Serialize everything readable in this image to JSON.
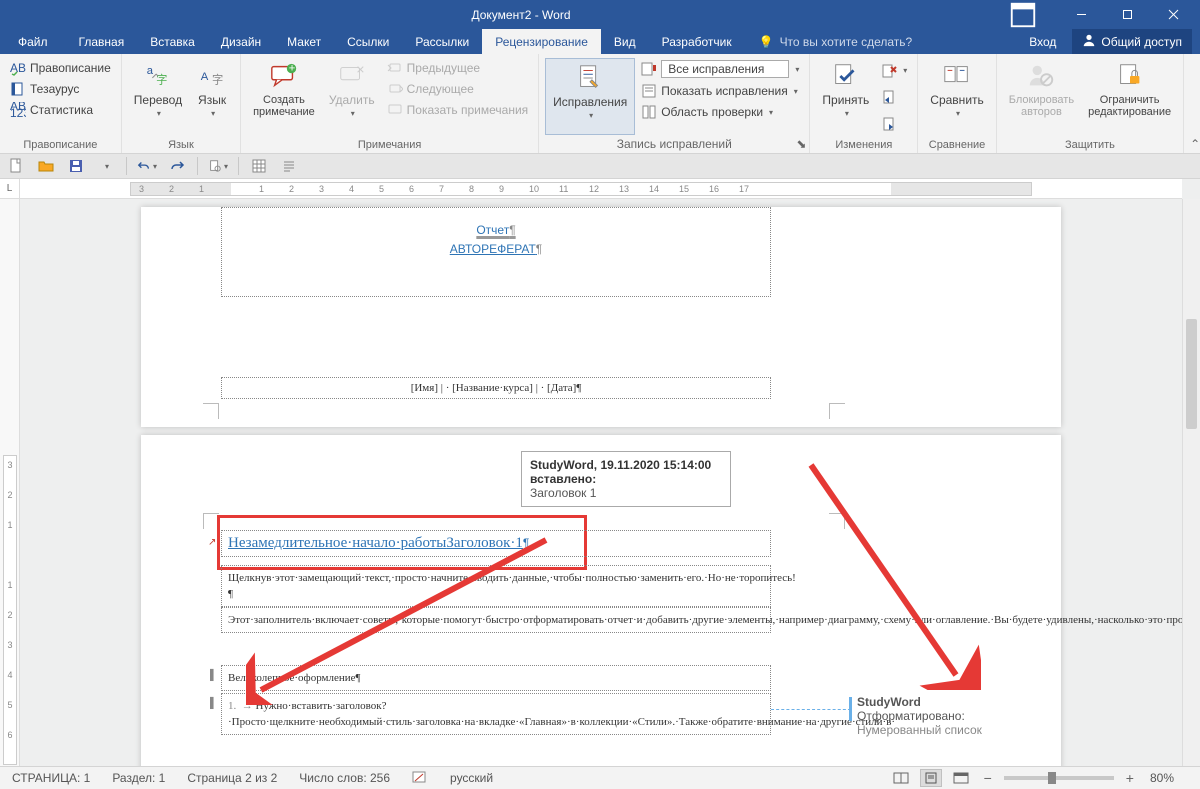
{
  "window": {
    "title": "Документ2 - Word"
  },
  "tabs": {
    "file": "Файл",
    "home": "Главная",
    "insert": "Вставка",
    "design": "Дизайн",
    "layout": "Макет",
    "references": "Ссылки",
    "mailings": "Рассылки",
    "review": "Рецензирование",
    "view": "Вид",
    "developer": "Разработчик",
    "tell_me": "Что вы хотите сделать?",
    "signin": "Вход",
    "share": "Общий доступ"
  },
  "ribbon": {
    "proofing": {
      "label": "Правописание",
      "spelling": "Правописание",
      "thesaurus": "Тезаурус",
      "stats": "Статистика"
    },
    "language": {
      "label": "Язык",
      "translate": "Перевод",
      "language": "Язык"
    },
    "comments": {
      "label": "Примечания",
      "new": "Создать\nпримечание",
      "delete": "Удалить",
      "previous": "Предыдущее",
      "next": "Следующее",
      "show": "Показать примечания"
    },
    "tracking": {
      "label": "Запись исправлений",
      "track": "Исправления",
      "display": "Все исправления",
      "show_markup": "Показать исправления",
      "reviewing_pane": "Область проверки"
    },
    "changes": {
      "label": "Изменения",
      "accept": "Принять"
    },
    "compare": {
      "label": "Сравнение",
      "compare": "Сравнить"
    },
    "protect": {
      "label": "Защитить",
      "block": "Блокировать\nавторов",
      "restrict": "Ограничить\nредактирование"
    }
  },
  "document": {
    "title": "Отчет",
    "subtitle": "АВТОРЕФЕРАТ",
    "meta_line": "[Имя] | · [Название·курса] | · [Дата]",
    "heading1_a": "Незамедлительное·начало·работы",
    "heading1_b": "Заголовок·1",
    "p1": "Щелкнув·этот·замещающий·текст,·просто·начните·вводить·данные,·чтобы·полностью·заменить·его.·Но·не·торопитесь!",
    "p2": "Этот·заполнитель·включает·советы,·которые·помогут·быстро·отформатировать·отчет·и·добавить·другие·элементы,·например·диаграмму,·схему·или·оглавление.·Вы·будете·удивлены,·насколько·это·просто.",
    "p3": "Великолепное·оформление",
    "p4": "Нужно·вставить·заголовок?·Просто·щелкните·необходимый·стиль·заголовка·на·вкладке·«Главная»·в·коллекции·«Стили».·Также·обратите·внимание·на·другие·стили·в·"
  },
  "tooltip": {
    "author_time": "StudyWord, 19.11.2020 15:14:00",
    "action": "вставлено:",
    "content": "Заголовок 1"
  },
  "comment": {
    "author": "StudyWord",
    "label": "Отформатировано:",
    "value": "Нумерованный список"
  },
  "status": {
    "page": "СТРАНИЦА: 1",
    "section": "Раздел: 1",
    "page_of": "Страница 2 из 2",
    "words": "Число слов: 256",
    "lang": "русский",
    "zoom": "80%"
  },
  "ruler_nums": [
    "3",
    "2",
    "1",
    "",
    "1",
    "2",
    "3",
    "4",
    "5",
    "6",
    "7",
    "8",
    "9",
    "10",
    "11",
    "12",
    "13",
    "14",
    "15",
    "16",
    "17"
  ]
}
